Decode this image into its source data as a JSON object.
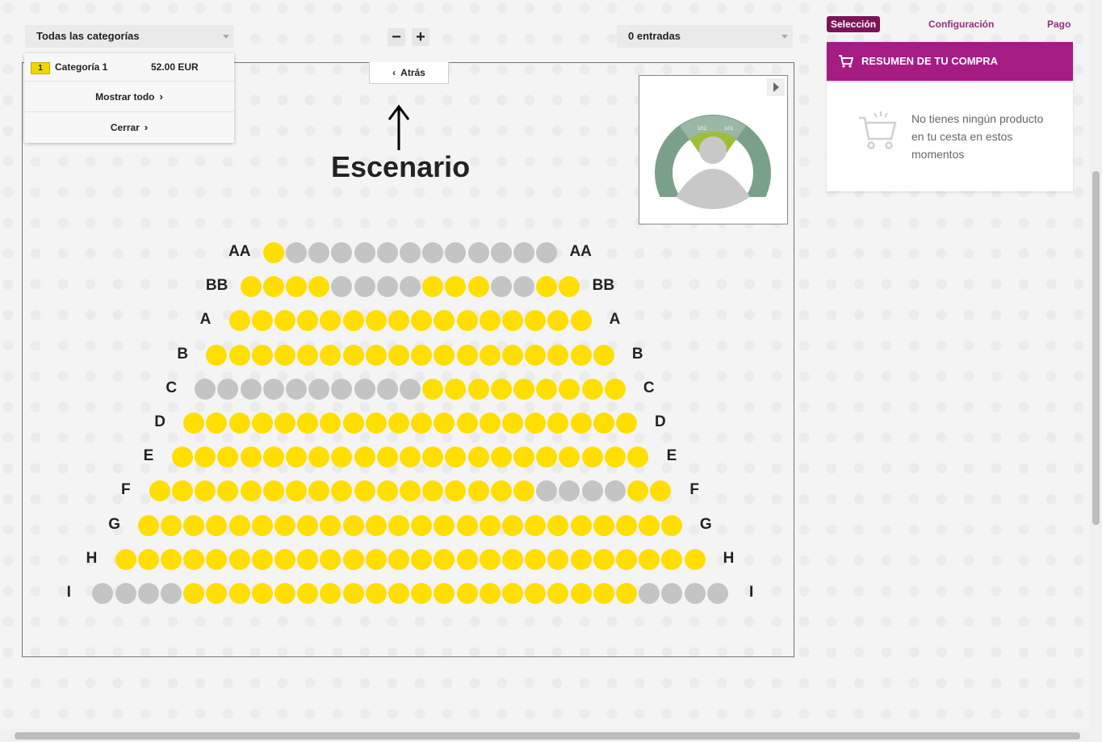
{
  "filters": {
    "category_select": "Todas las categorías",
    "tickets_select": "0 entradas"
  },
  "zoom": {
    "minus": "−",
    "plus": "+"
  },
  "category_panel": {
    "badge": "1",
    "name": "Categoría 1",
    "price": "52.00 EUR",
    "show_all": "Mostrar todo",
    "close": "Cerrar"
  },
  "back_label": "Atrás",
  "stage_label": "Escenario",
  "steps": {
    "selection": "Selección",
    "configuration": "Configuración",
    "payment": "Pago"
  },
  "summary": {
    "title": "RESUMEN DE TU COMPRA",
    "empty_message": "No tienes ningún producto en tu cesta en estos momentos"
  },
  "colors": {
    "available": "#ffde00",
    "unavailable": "#c4c4c4",
    "accent": "#a51c85",
    "step_active": "#7a1457"
  },
  "minimap": {
    "sections": [
      "200",
      "201",
      "202",
      "203",
      "204",
      "205",
      "206",
      "101",
      "102",
      "103",
      "104"
    ]
  },
  "seat_rows": [
    {
      "label": "AA",
      "seats": "ynnnnnnnnnnnn"
    },
    {
      "label": "BB",
      "seats": "yyyynnnnyyynnyy"
    },
    {
      "label": "A",
      "seats": "yyyyyyyyyyyyyyyy"
    },
    {
      "label": "B",
      "seats": "yyyyyyyyyyyyyyyyyy"
    },
    {
      "label": "C",
      "seats": "nnnnnnnnnnyyyyyyyyy"
    },
    {
      "label": "D",
      "seats": "yyyyyyyyyyyyyyyyyyyy"
    },
    {
      "label": "E",
      "seats": "yyyyyyyyyyyyyyyyyyyyy"
    },
    {
      "label": "F",
      "seats": "yyyyyyyyyyyyyyyyynnnnyy"
    },
    {
      "label": "G",
      "seats": "yyyyyyyyyyyyyyyyyyyyyyyy"
    },
    {
      "label": "H",
      "seats": "yyyyyyyyyyyyyyyyyyyyyyyyyy"
    },
    {
      "label": "I",
      "seats": "nnnnyyyyyyyyyyyyyyyyyyyynnnn"
    }
  ]
}
